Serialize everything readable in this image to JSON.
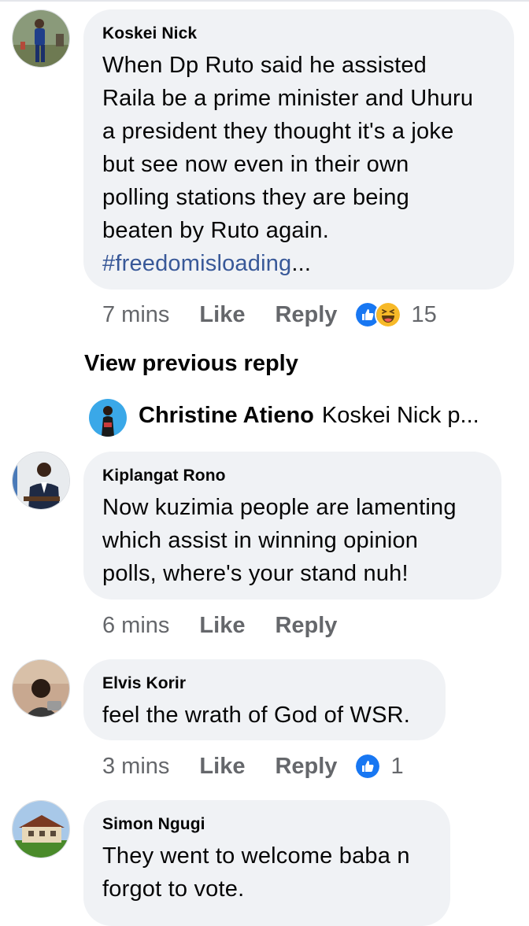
{
  "comments": [
    {
      "author": "Koskei Nick",
      "lines": [
        "When Dp Ruto said he assisted",
        "Raila be a prime minister and Uhuru",
        "a president they thought it's a joke",
        "but see now even in their own",
        "polling stations they are being",
        "beaten by Ruto again."
      ],
      "hashtag": "#freedomisloading",
      "ellipsis": "...",
      "time": "7 mins",
      "like_label": "Like",
      "reply_label": "Reply",
      "reactions": [
        "like-icon",
        "haha-icon"
      ],
      "reaction_count": "15"
    },
    {
      "author": "Kiplangat Rono",
      "lines": [
        "Now kuzimia people are lamenting",
        "which assist in winning opinion",
        "polls, where's your stand nuh!"
      ],
      "time": "6 mins",
      "like_label": "Like",
      "reply_label": "Reply"
    },
    {
      "author": "Elvis Korir",
      "lines": [
        "feel the wrath of God of WSR."
      ],
      "time": "3 mins",
      "like_label": "Like",
      "reply_label": "Reply",
      "reactions": [
        "like-icon"
      ],
      "reaction_count": "1"
    },
    {
      "author": "Simon Ngugi",
      "lines": [
        "They went to welcome baba n",
        "forgot to vote."
      ]
    }
  ],
  "view_previous_reply": "View previous reply",
  "reply_preview": {
    "author": "Christine Atieno",
    "snippet": "Koskei Nick p..."
  },
  "colors": {
    "bubble": "#f0f2f5",
    "meta_text": "#65676b",
    "hashtag": "#385898",
    "like_blue": "#1877f2",
    "haha_yellow": "#f7b928"
  }
}
